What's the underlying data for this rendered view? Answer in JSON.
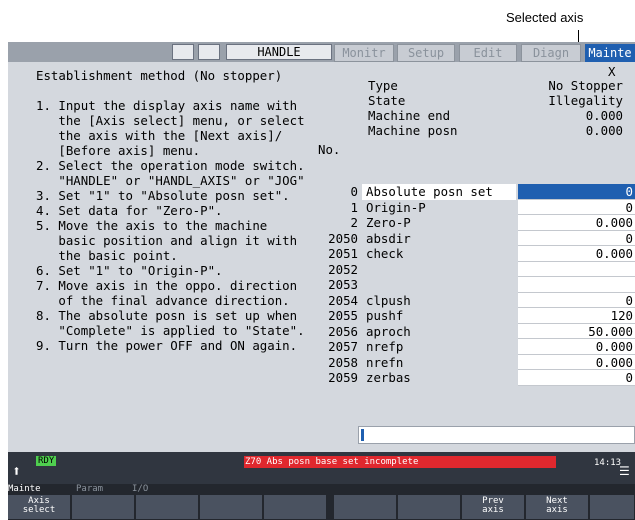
{
  "callout": {
    "label": "Selected axis"
  },
  "topbar": {
    "mode": "HANDLE",
    "tabs": [
      {
        "label": "Monitr",
        "active": false
      },
      {
        "label": "Setup",
        "active": false
      },
      {
        "label": "Edit",
        "active": false
      },
      {
        "label": "Diagn",
        "active": false
      },
      {
        "label": "Mainte",
        "active": true
      }
    ]
  },
  "instructions": [
    "Establishment method (No stopper)",
    "",
    "1. Input the display axis name with",
    "   the [Axis select] menu, or select",
    "   the axis with the [Next axis]/",
    "   [Before axis] menu.",
    "2. Select the operation mode switch.",
    "   \"HANDLE\" or \"HANDL_AXIS\" or \"JOG\"",
    "3. Set \"1\" to \"Absolute posn set\".",
    "4. Set data for \"Zero-P\".",
    "5. Move the axis to the machine",
    "   basic position and align it with",
    "   the basic point.",
    "6. Set \"1\" to \"Origin-P\".",
    "7. Move axis in the oppo. direction",
    "   of the final advance direction.",
    "8. The absolute posn is set up when",
    "   \"Complete\" is applied to \"State\".",
    "9. Turn the power OFF and ON again."
  ],
  "info": {
    "axis": "X",
    "rows": [
      {
        "key": "Type",
        "value": "No Stopper"
      },
      {
        "key": "State",
        "value": "Illegality"
      },
      {
        "key": "Machine end",
        "value": "0.000"
      },
      {
        "key": "Machine posn",
        "value": "0.000"
      }
    ]
  },
  "table": {
    "no_header": "No.",
    "rows": [
      {
        "no": "0",
        "name": "Absolute posn set",
        "value": "0"
      },
      {
        "no": "1",
        "name": "Origin-P",
        "value": "0"
      },
      {
        "no": "2",
        "name": "Zero-P",
        "value": "0.000"
      },
      {
        "no": "2050",
        "name": "absdir",
        "value": "0"
      },
      {
        "no": "2051",
        "name": "check",
        "value": "0.000"
      },
      {
        "no": "2052",
        "name": "",
        "value": ""
      },
      {
        "no": "2053",
        "name": "",
        "value": ""
      },
      {
        "no": "2054",
        "name": "clpush",
        "value": "0"
      },
      {
        "no": "2055",
        "name": "pushf",
        "value": "120"
      },
      {
        "no": "2056",
        "name": "aproch",
        "value": "50.000"
      },
      {
        "no": "2057",
        "name": "nrefp",
        "value": "0.000"
      },
      {
        "no": "2058",
        "name": "nrefn",
        "value": "0.000"
      },
      {
        "no": "2059",
        "name": "zerbas",
        "value": "0"
      }
    ]
  },
  "status": {
    "ready": "RDY",
    "alarm": "Z70  Abs posn base set incomplete",
    "time": "14:13"
  },
  "modebar": {
    "mainte": "Mainte",
    "param": "Param",
    "io": "I/O"
  },
  "fkeys": [
    {
      "line1": "Axis",
      "line2": "select"
    },
    {
      "line1": "",
      "line2": ""
    },
    {
      "line1": "",
      "line2": ""
    },
    {
      "line1": "",
      "line2": ""
    },
    {
      "line1": "",
      "line2": ""
    },
    {
      "line1": "",
      "line2": ""
    },
    {
      "line1": "",
      "line2": ""
    },
    {
      "line1": "Prev",
      "line2": "axis"
    },
    {
      "line1": "Next",
      "line2": "axis"
    },
    {
      "line1": "",
      "line2": ""
    }
  ],
  "colors": {
    "accent": "#1f5fb0",
    "alarm": "#e0282e",
    "ready": "#4fcf4f"
  }
}
